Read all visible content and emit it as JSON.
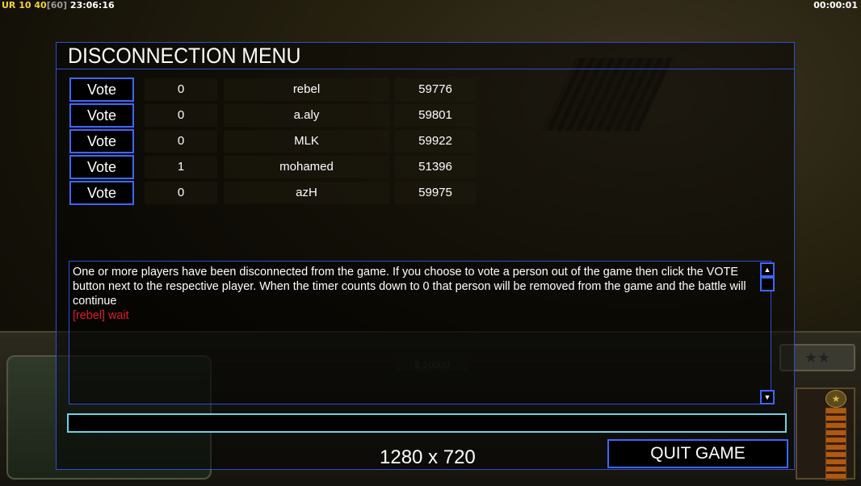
{
  "status_bar": {
    "left_prefix": "UR",
    "left_numbers": "10 40",
    "left_bracket": "[60]",
    "left_time": "23:06:16",
    "right_time": "00:00:01"
  },
  "background": {
    "money": "$ 10000",
    "stars": "★★"
  },
  "dialog": {
    "title": "DISCONNECTION MENU",
    "vote_label": "Vote",
    "players": [
      {
        "votes": "0",
        "name": "rebel",
        "ping": "59776"
      },
      {
        "votes": "0",
        "name": "a.aly",
        "ping": "59801"
      },
      {
        "votes": "0",
        "name": "MLK",
        "ping": "59922"
      },
      {
        "votes": "1",
        "name": "mohamed",
        "ping": "51396"
      },
      {
        "votes": "0",
        "name": "azH",
        "ping": "59975"
      }
    ],
    "message": "One or more players have been disconnected from the game. If you choose to vote a person out of the game then click the VOTE button next to the respective player. When the timer counts down to 0 that person will be removed from the game and the battle will continue",
    "alert": "[rebel] wait",
    "chat_value": "",
    "quit_label": "QUIT GAME",
    "resolution": "1280 x 720"
  },
  "colors": {
    "accent_border": "#3e67ff",
    "chat_border": "#69d4e6",
    "alert": "#e0192a"
  }
}
